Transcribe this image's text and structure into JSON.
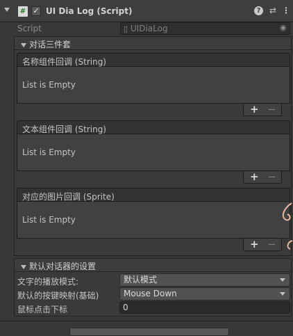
{
  "component": {
    "title": "UI Dia Log (Script)",
    "script_label": "Script",
    "script_value": "UIDiaLog"
  },
  "dialog_group": {
    "label": "对话三件套",
    "lists": [
      {
        "header": "名称组件回调 (String)",
        "empty_text": "List is Empty",
        "add": "+",
        "remove": "−"
      },
      {
        "header": "文本组件回调 (String)",
        "empty_text": "List is Empty",
        "add": "+",
        "remove": "−"
      },
      {
        "header": "对应的图片回调 (Sprite)",
        "empty_text": "List is Empty",
        "add": "+",
        "remove": "−"
      }
    ]
  },
  "settings_group": {
    "label": "默认对话器的设置",
    "rows": [
      {
        "label": "文字的播放模式:",
        "value": "默认模式"
      },
      {
        "label": "默认的按键映射(基础)",
        "value": "Mouse Down"
      },
      {
        "label": "鼠标点击下标",
        "value": "0"
      }
    ]
  },
  "icons": {
    "hash": "#",
    "check": "✓",
    "help": "?",
    "preset": "⇄",
    "more": "⋮",
    "target": "◉",
    "script_file": "▯"
  }
}
